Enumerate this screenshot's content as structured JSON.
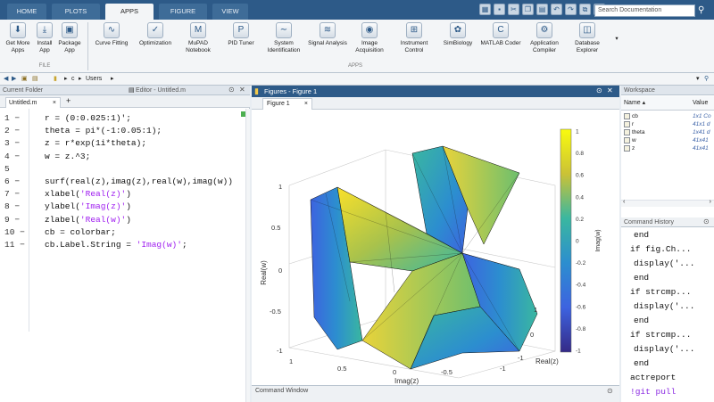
{
  "tabs": [
    "HOME",
    "PLOTS",
    "APPS",
    "FIGURE",
    "VIEW"
  ],
  "search": {
    "placeholder": "Search Documentation"
  },
  "ribbon": {
    "file_buttons": [
      "Get More Apps",
      "Install App",
      "Package App"
    ],
    "apps": [
      "Curve Fitting",
      "Optimization",
      "MuPAD Notebook",
      "PID Tuner",
      "System Identification",
      "Signal Analysis",
      "Image Acquisition",
      "Instrument Control",
      "SimBiology",
      "MATLAB Coder",
      "Application Compiler",
      "Database Explorer"
    ],
    "group_file": "FILE",
    "group_apps": "APPS"
  },
  "address": {
    "path": [
      "c",
      "Users"
    ]
  },
  "editor": {
    "current_folder": "Current Folder",
    "title": "Editor - Untitled.m",
    "tab": "Untitled.m",
    "lines": [
      {
        "n": "1 −",
        "code": "r = (0:0.025:1)';"
      },
      {
        "n": "2 −",
        "code": "theta = pi*(-1:0.05:1);"
      },
      {
        "n": "3 −",
        "code": "z = r*exp(1i*theta);"
      },
      {
        "n": "4 −",
        "code": "w = z.^3;"
      },
      {
        "n": "5",
        "code": ""
      },
      {
        "n": "6 −",
        "code": "surf(real(z),imag(z),real(w),imag(w))"
      },
      {
        "n": "7 −",
        "pre": "xlabel(",
        "str": "'Real(z)'",
        "post": ")"
      },
      {
        "n": "8 −",
        "pre": "ylabel(",
        "str": "'Imag(z)'",
        "post": ")"
      },
      {
        "n": "9 −",
        "pre": "zlabel(",
        "str": "'Real(w)'",
        "post": ")"
      },
      {
        "n": "10 −",
        "code": "cb = colorbar;"
      },
      {
        "n": "11 −",
        "pre": "cb.Label.String = ",
        "str": "'Imag(w)'",
        "post": ";"
      }
    ]
  },
  "figure": {
    "title": "Figures - Figure 1",
    "tab": "Figure 1",
    "zlabel": "Real(w)",
    "ylabel": "Imag(z)",
    "xlabel": "Real(z)",
    "cblabel": "Imag(w)",
    "zticks": [
      "1",
      "0.5",
      "0",
      "-0.5",
      "-1"
    ],
    "yticks": [
      "1",
      "0.5",
      "0",
      "-0.5",
      "-1"
    ],
    "xticks": [
      "1",
      "0",
      "-1"
    ],
    "cbticks": [
      "1",
      "0.8",
      "0.6",
      "0.4",
      "0.2",
      "0",
      "-0.2",
      "-0.4",
      "-0.6",
      "-0.8",
      "-1"
    ]
  },
  "command_window": {
    "title": "Command Window"
  },
  "workspace": {
    "title": "Workspace",
    "col_name": "Name ▴",
    "col_value": "Value",
    "rows": [
      {
        "name": "cb",
        "value": "1x1 Co"
      },
      {
        "name": "r",
        "value": "41x1 d"
      },
      {
        "name": "theta",
        "value": "1x41 d"
      },
      {
        "name": "w",
        "value": "41x41"
      },
      {
        "name": "z",
        "value": "41x41"
      }
    ]
  },
  "history": {
    "title": "Command History",
    "lines": [
      "end",
      "if fig.Ch...",
      "display('...",
      "end",
      "if strcmp...",
      "display('...",
      "end",
      "if strcmp...",
      "display('...",
      "end",
      "actreport",
      "!git pull"
    ]
  },
  "colors": {
    "accent": "#2d5a88",
    "string": "#a020f0"
  }
}
